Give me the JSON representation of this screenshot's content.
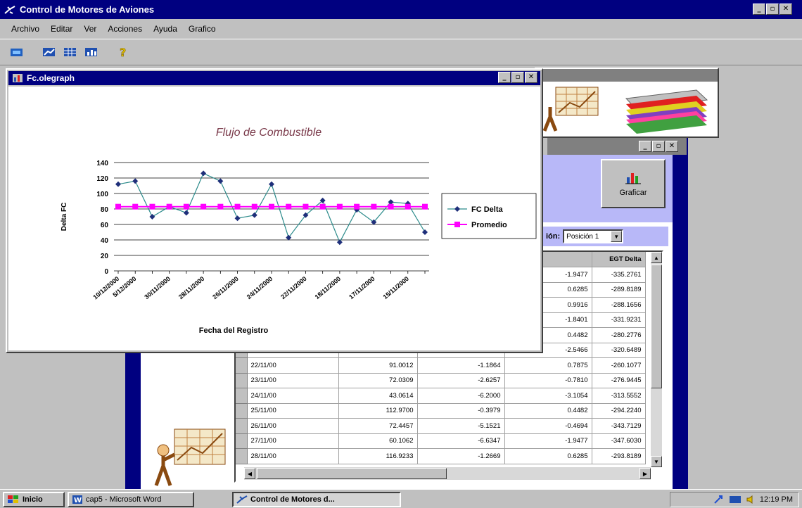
{
  "app": {
    "title": "Control de Motores de Aviones",
    "menu": [
      "Archivo",
      "Editar",
      "Ver",
      "Acciones",
      "Ayuda",
      "Grafico"
    ],
    "toolbar_icons": [
      "open-icon",
      "graph-icon",
      "table-icon",
      "chart-icon",
      "help-icon"
    ]
  },
  "form": {
    "graficar_label": "Graficar",
    "position_label": "ión:",
    "position_value": "Posición 1",
    "grid": {
      "headers": [
        "",
        "",
        "",
        "",
        "EGT Delta"
      ],
      "rows": [
        [
          "",
          "",
          "",
          "-1.9477",
          "-335.2761"
        ],
        [
          "",
          "",
          "",
          "0.6285",
          "-289.8189"
        ],
        [
          "",
          "",
          "",
          "0.9916",
          "-288.1656"
        ],
        [
          "",
          "",
          "",
          "-1.8401",
          "-331.9231"
        ],
        [
          "",
          "",
          "",
          "0.4482",
          "-280.2776"
        ],
        [
          "",
          "",
          "",
          "-2.5466",
          "-320.6489"
        ],
        [
          "22/11/00",
          "91.0012",
          "-1.1864",
          "0.7875",
          "-260.1077"
        ],
        [
          "23/11/00",
          "72.0309",
          "-2.6257",
          "-0.7810",
          "-276.9445"
        ],
        [
          "24/11/00",
          "43.0614",
          "-6.2000",
          "-3.1054",
          "-313.5552"
        ],
        [
          "25/11/00",
          "112.9700",
          "-0.3979",
          "0.4482",
          "-294.2240"
        ],
        [
          "26/11/00",
          "72.4457",
          "-5.1521",
          "-0.4694",
          "-343.7129"
        ],
        [
          "27/11/00",
          "60.1062",
          "-6.6347",
          "-1.9477",
          "-347.6030"
        ],
        [
          "28/11/00",
          "116.9233",
          "-1.2669",
          "0.6285",
          "-293.8189"
        ]
      ]
    }
  },
  "chart_window": {
    "title": "Fc.olegraph"
  },
  "chart_data": {
    "type": "line",
    "title": "Flujo de Combustible",
    "xlabel": "Fecha del Registro",
    "ylabel": "Delta FC",
    "ylim": [
      0,
      140
    ],
    "yticks": [
      "0",
      "20",
      "40",
      "60",
      "80",
      "100",
      "120",
      "140"
    ],
    "categories": [
      "10/12/2000",
      "5/12/2000",
      "",
      "30/11/2000",
      "",
      "28/11/2000",
      "",
      "26/11/2000",
      "",
      "24/11/2000",
      "",
      "22/11/2000",
      "",
      "18/11/2000",
      "",
      "17/11/2000",
      "",
      "15/11/2000"
    ],
    "series": [
      {
        "name": "FC Delta",
        "color": "#1f2f7a",
        "values": [
          112,
          116,
          70,
          83,
          75,
          126,
          116,
          68,
          72,
          112,
          43,
          72,
          91,
          37,
          79,
          63,
          89,
          87,
          50
        ]
      },
      {
        "name": "Promedio",
        "color": "#ff00ff",
        "values": [
          83,
          83,
          83,
          83,
          83,
          83,
          83,
          83,
          83,
          83,
          83,
          83,
          83,
          83,
          83,
          83,
          83,
          83,
          83
        ]
      }
    ],
    "legend": "right",
    "grid": true
  },
  "taskbar": {
    "start": "Inicio",
    "items": [
      "cap5 - Microsoft Word",
      "Control de Motores d..."
    ],
    "clock": "12:19 PM"
  }
}
